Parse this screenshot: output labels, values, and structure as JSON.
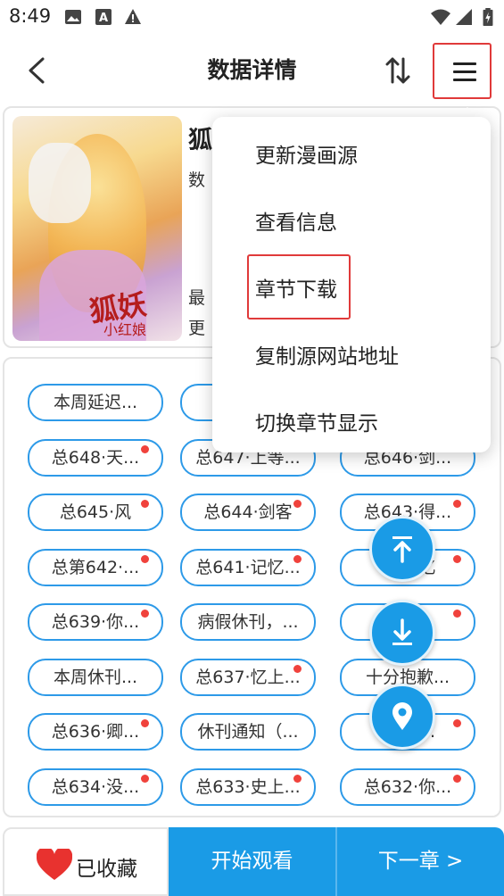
{
  "status_bar": {
    "time": "8:49",
    "left_icons": [
      "image-icon",
      "a-box-icon",
      "alert-icon"
    ],
    "right_icons": [
      "wifi-icon",
      "signal-icon",
      "battery-icon"
    ]
  },
  "header": {
    "title": "数据详情",
    "icons": [
      "back-arrow-icon",
      "sort-icon",
      "menu-icon"
    ]
  },
  "comic": {
    "title_visible": "狐",
    "line1_visible": "数",
    "line2_visible": "最",
    "line3_visible": "更",
    "cover_logo": "狐妖",
    "cover_logo_sub": "小红娘"
  },
  "chapters": [
    {
      "label": "本周延迟...",
      "new": false
    },
    {
      "label": "总",
      "new": false
    },
    {
      "label": "",
      "new": false
    },
    {
      "label": "总648·天...",
      "new": true
    },
    {
      "label": "总647·上等...",
      "new": false
    },
    {
      "label": "总646·剑...",
      "new": false
    },
    {
      "label": "总645·风",
      "new": true
    },
    {
      "label": "总644·剑客",
      "new": true
    },
    {
      "label": "总643·得...",
      "new": true
    },
    {
      "label": "总第642·...",
      "new": true
    },
    {
      "label": "总641·记忆...",
      "new": true
    },
    {
      "label": "总 记忆",
      "new": true
    },
    {
      "label": "总639·你...",
      "new": true
    },
    {
      "label": "病假休刊，...",
      "new": false
    },
    {
      "label": "总 地...",
      "new": true
    },
    {
      "label": "本周休刊...",
      "new": false
    },
    {
      "label": "总637·忆上...",
      "new": true
    },
    {
      "label": "十分抱歉...",
      "new": false
    },
    {
      "label": "总636·卿...",
      "new": true
    },
    {
      "label": "休刊通知（...",
      "new": false
    },
    {
      "label": "总 自...",
      "new": true
    },
    {
      "label": "总634·没...",
      "new": true
    },
    {
      "label": "总633·史上...",
      "new": true
    },
    {
      "label": "总632·你...",
      "new": true
    }
  ],
  "popup_menu": {
    "items": [
      "更新漫画源",
      "查看信息",
      "章节下载",
      "复制源网站地址",
      "切换章节显示"
    ],
    "highlighted": "章节下载"
  },
  "fabs": [
    "scroll-top-icon",
    "scroll-bottom-icon",
    "locate-icon"
  ],
  "bottom_bar": {
    "collect_label": "已收藏",
    "start_label": "开始观看",
    "next_label": "下一章 >"
  },
  "colors": {
    "accent": "#1a9be6",
    "badge": "#f0423c",
    "highlight": "#e03a3a",
    "heart": "#e8322f"
  }
}
